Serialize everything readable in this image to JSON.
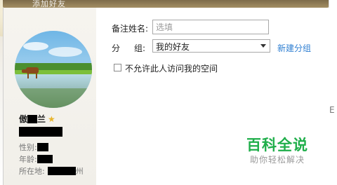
{
  "window": {
    "title": "添加好友"
  },
  "profile": {
    "nickname_visible_start": "傲",
    "nickname_visible_end": "兰",
    "star_icon": "star-icon",
    "gender_label": "性别:",
    "age_label": "年龄:",
    "location_label": "所在地:",
    "location_visible_end": "州"
  },
  "form": {
    "remark_label": "备注姓名:",
    "remark_placeholder": "选填",
    "remark_value": "",
    "group_label_char1": "分",
    "group_label_char2": "组:",
    "group_selected": "我的好友",
    "new_group_link": "新建分组",
    "privacy_checkbox_label": "不允许此人访问我的空间",
    "privacy_checked": false
  },
  "watermark": {
    "title": "百科全说",
    "subtitle": "助你轻松解决"
  },
  "right_strip": {
    "glyph": "E"
  },
  "colors": {
    "link": "#2f7fd2",
    "watermark_green": "#1fae4a",
    "star": "#e8b52c",
    "titlebar": "#8f7b55"
  }
}
